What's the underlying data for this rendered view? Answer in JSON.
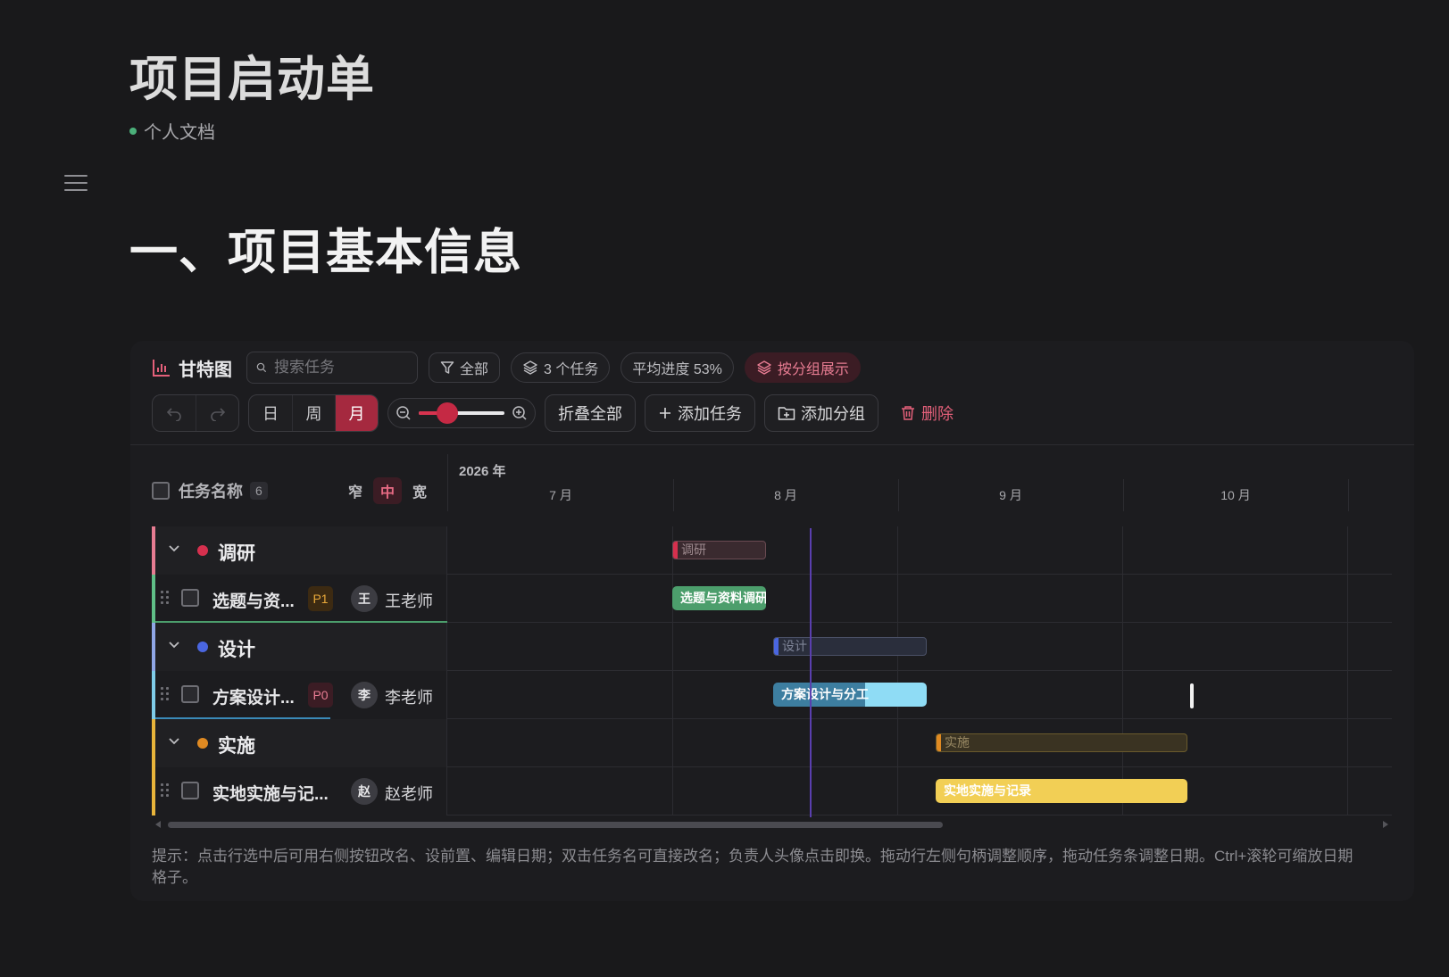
{
  "doc": {
    "title": "项目启动单",
    "meta": "个人文档",
    "heading": "一、项目基本信息"
  },
  "toolbar": {
    "gantt_title": "甘特图",
    "search_placeholder": "搜索任务",
    "filter_label": "全部",
    "task_count_label": "3 个任务",
    "avg_progress_label": "平均进度 53%",
    "group_view_label": "按分组展示",
    "view_day": "日",
    "view_week": "周",
    "view_month": "月",
    "collapse_all": "折叠全部",
    "add_task": "添加任务",
    "add_group": "添加分组",
    "delete": "删除",
    "zoom_level": 0.33
  },
  "grid": {
    "header_label": "任务名称",
    "count": "6",
    "density": [
      "窄",
      "中",
      "宽"
    ],
    "active_density": "中",
    "year": "2026 年",
    "months": [
      "7 月",
      "8 月",
      "9 月",
      "10 月"
    ]
  },
  "rows": [
    {
      "type": "group",
      "name": "调研",
      "color": "#d6304e",
      "bar_label": "调研"
    },
    {
      "type": "task",
      "name": "选题与资...",
      "priority": "P1",
      "avatar": "王",
      "owner": "王老师",
      "bar_label": "选题与资料调研",
      "color": "#4c9e6c",
      "progress": 1.0
    },
    {
      "type": "group",
      "name": "设计",
      "color": "#4a66e0",
      "bar_label": "设计"
    },
    {
      "type": "task",
      "name": "方案设计...",
      "priority": "P0",
      "avatar": "李",
      "owner": "李老师",
      "bar_label": "方案设计与分工",
      "color": "#8fdcf5",
      "progress": 0.6
    },
    {
      "type": "group",
      "name": "实施",
      "color": "#e08a22",
      "bar_label": "实施"
    },
    {
      "type": "task",
      "name": "实地实施与记...",
      "priority": "",
      "avatar": "赵",
      "owner": "赵老师",
      "bar_label": "实地实施与记录",
      "color": "#f2cf55",
      "progress": 0.0
    }
  ],
  "hint": "提示：点击行选中后可用右侧按钮改名、设前置、编辑日期；双击任务名可直接改名；负责人头像点击即换。拖动行左侧句柄调整顺序，拖动任务条调整日期。Ctrl+滚轮可缩放日期格子。"
}
